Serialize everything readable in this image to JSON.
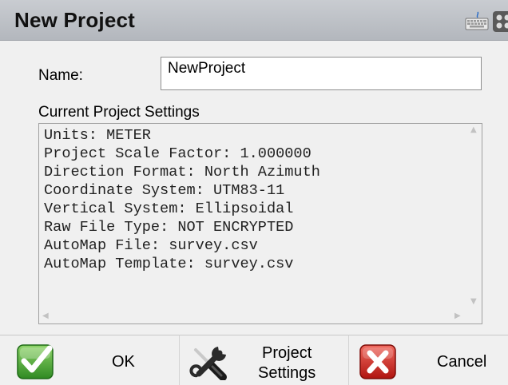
{
  "window": {
    "title": "New Project"
  },
  "name_row": {
    "label": "Name:",
    "value": "NewProject"
  },
  "settings": {
    "label": "Current Project Settings",
    "lines": [
      "Units: METER",
      "Project Scale Factor: 1.000000",
      "Direction Format: North Azimuth",
      "Coordinate System: UTM83-11",
      "Vertical System: Ellipsoidal",
      "Raw File Type: NOT ENCRYPTED",
      "AutoMap File: survey.csv",
      "AutoMap Template: survey.csv"
    ]
  },
  "buttons": {
    "ok_label": "OK",
    "project_settings_line1": "Project",
    "project_settings_line2": "Settings",
    "cancel_label": "Cancel"
  },
  "icons": {
    "keyboard": "keyboard-icon",
    "window_control": "window-control-icon",
    "ok": "checkmark-icon",
    "project_settings": "wrench-screwdriver-icon",
    "cancel": "x-mark-icon"
  },
  "colors": {
    "ok_green": "#3a9a2a",
    "cancel_red": "#c8201e",
    "title_bar": "#c0c3c8"
  }
}
